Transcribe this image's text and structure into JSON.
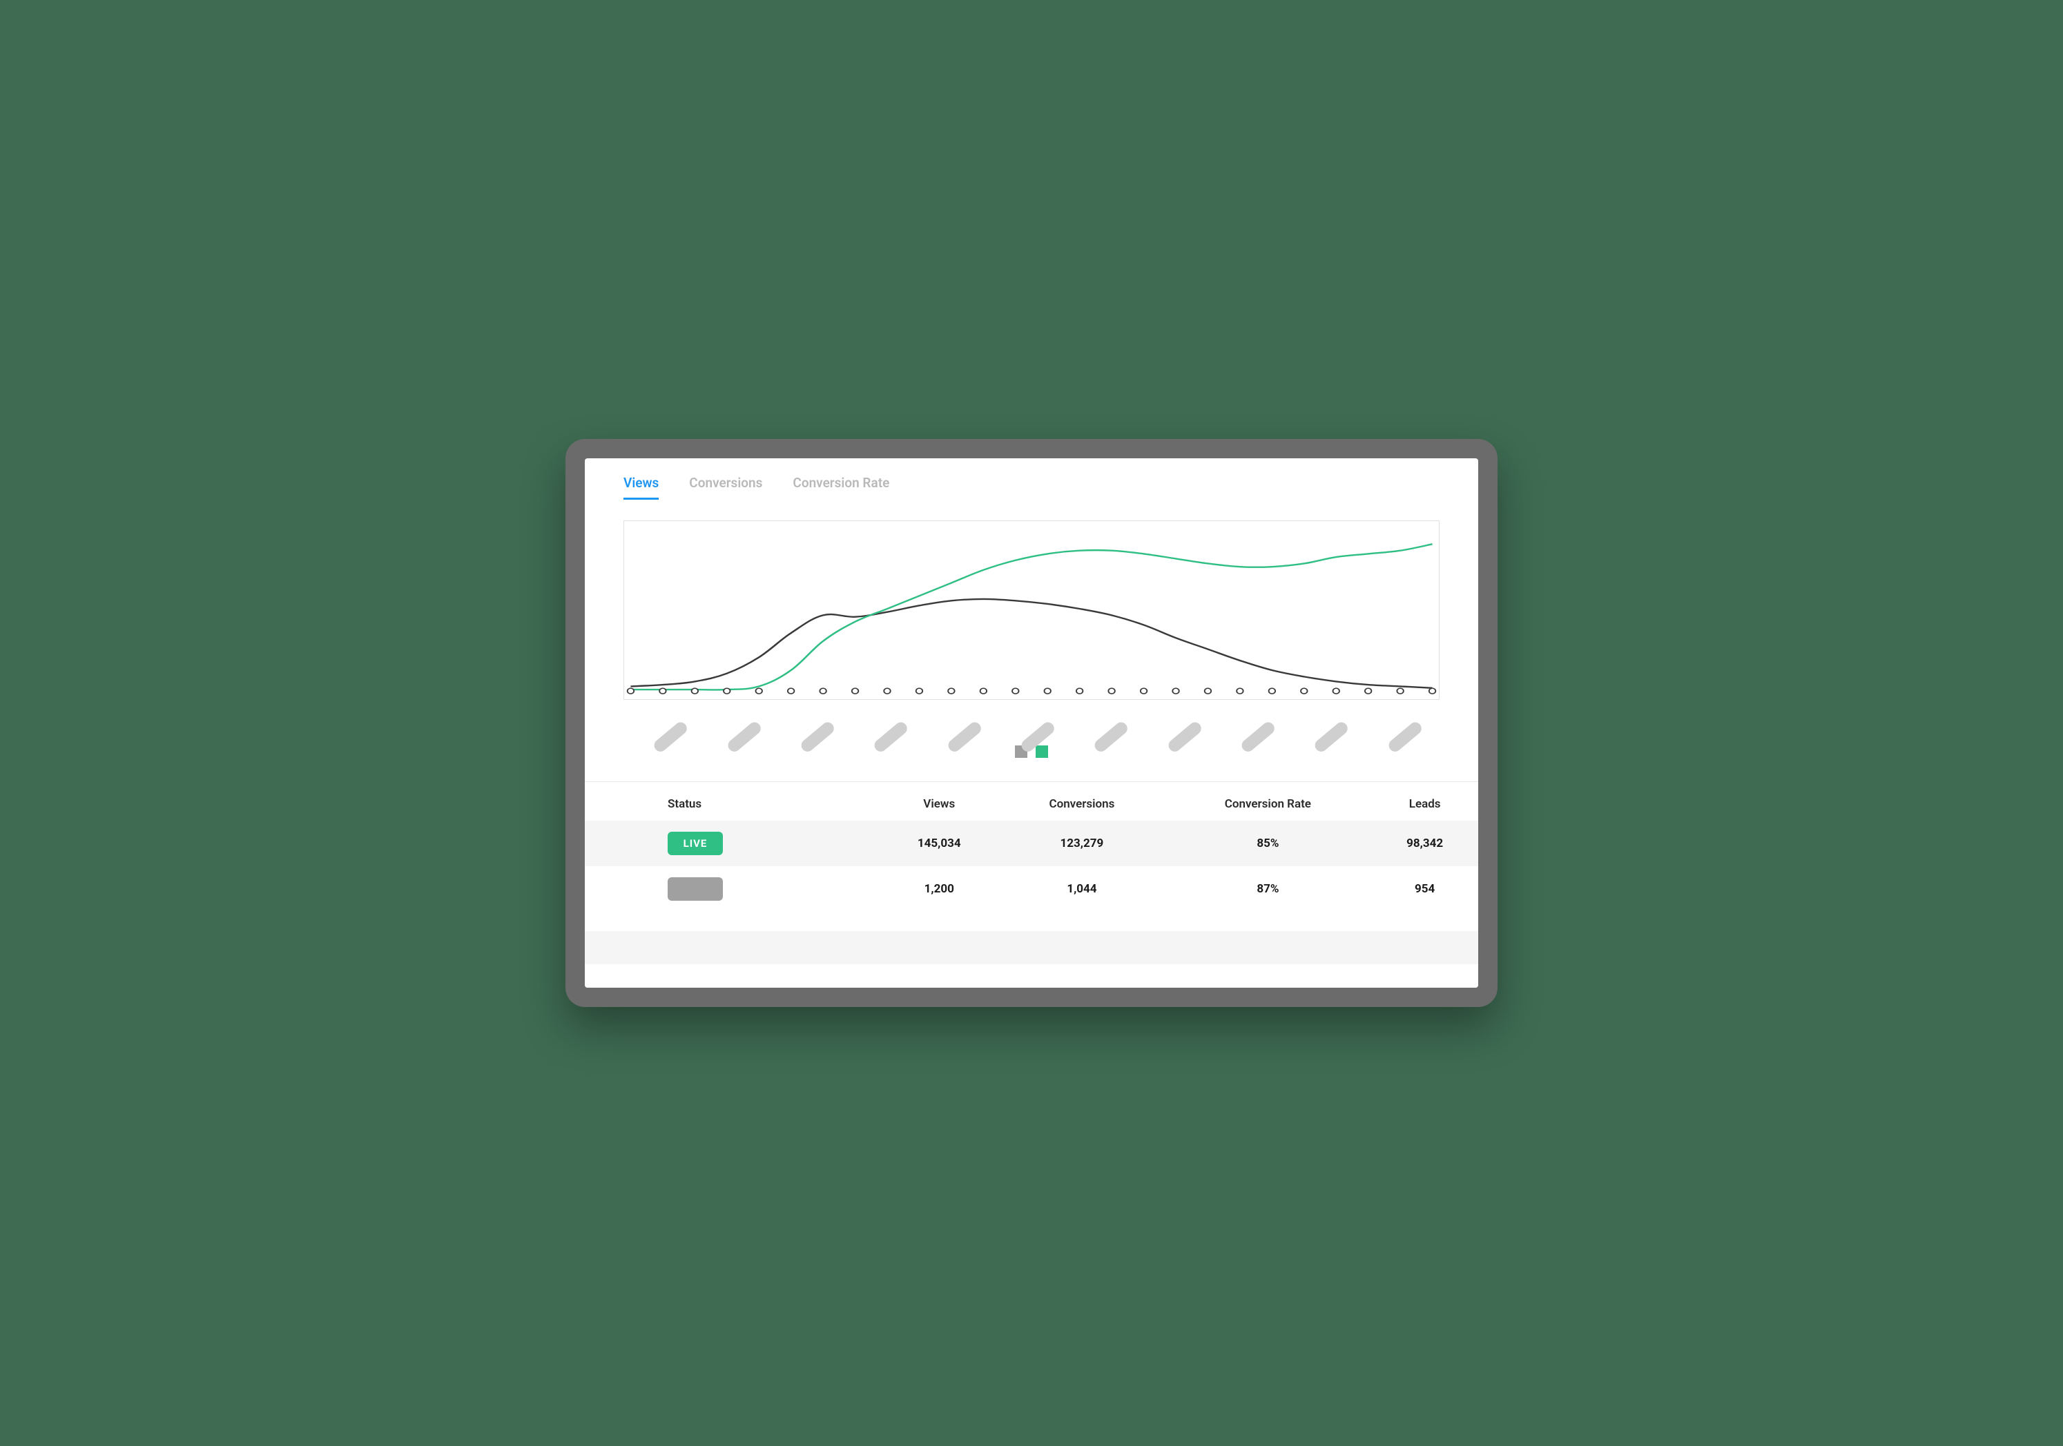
{
  "tabs": {
    "views": "Views",
    "conversions": "Conversions",
    "conversion_rate": "Conversion Rate",
    "active": "views"
  },
  "legend": {
    "series1_color": "#9e9e9e",
    "series2_color": "#2fbf84"
  },
  "chart_data": {
    "type": "line",
    "title": "",
    "xlabel": "",
    "ylabel": "",
    "x": [
      0,
      1,
      2,
      3,
      4,
      5,
      6,
      7,
      8,
      9,
      10,
      11,
      12,
      13,
      14,
      15,
      16,
      17,
      18,
      19,
      20,
      21,
      22,
      23,
      24,
      25
    ],
    "ylim": [
      0,
      100
    ],
    "series": [
      {
        "name": "series-gray",
        "color": "#3a3a3a",
        "values": [
          2,
          3,
          5,
          10,
          20,
          35,
          46,
          45,
          48,
          52,
          55,
          56,
          55,
          53,
          50,
          46,
          40,
          32,
          25,
          18,
          12,
          8,
          5,
          3,
          2,
          1
        ]
      },
      {
        "name": "series-green",
        "color": "#2fbf84",
        "values": [
          0,
          0,
          0,
          0,
          2,
          12,
          30,
          42,
          50,
          58,
          66,
          74,
          80,
          84,
          86,
          86,
          84,
          81,
          78,
          76,
          76,
          78,
          82,
          84,
          86,
          90
        ]
      }
    ],
    "x_markers_count": 26,
    "x_label_placeholders": 11
  },
  "table": {
    "headers": {
      "status": "Status",
      "views": "Views",
      "conversions": "Conversions",
      "conversion_rate": "Conversion Rate",
      "leads": "Leads"
    },
    "rows": [
      {
        "status_label": "LIVE",
        "status_kind": "live",
        "views": "145,034",
        "conversions": "123,279",
        "conversion_rate": "85%",
        "leads": "98,342"
      },
      {
        "status_label": "",
        "status_kind": "gray",
        "views": "1,200",
        "conversions": "1,044",
        "conversion_rate": "87%",
        "leads": "954"
      }
    ]
  }
}
